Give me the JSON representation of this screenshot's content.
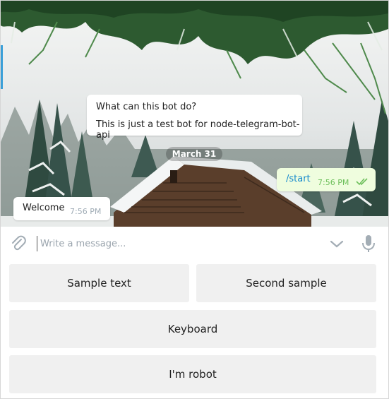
{
  "chat": {
    "bot_info": {
      "title": "What can this bot do?",
      "description": "This is just a test bot for node-telegram-bot-api"
    },
    "date_separator": "March 31",
    "messages": [
      {
        "direction": "outgoing",
        "text": "/start",
        "time": "7:56 PM",
        "status": "read"
      },
      {
        "direction": "incoming",
        "text": "Welcome",
        "time": "7:56 PM"
      }
    ]
  },
  "composer": {
    "placeholder": "Write a message..."
  },
  "keyboard": {
    "rows": [
      [
        "Sample text",
        "Second sample"
      ],
      [
        "Keyboard"
      ],
      [
        "I'm robot"
      ]
    ]
  },
  "colors": {
    "link_blue": "#168acd",
    "outgoing_bubble": "#effdde",
    "check_green": "#6cbf5a",
    "key_bg": "#f0f0f0"
  }
}
